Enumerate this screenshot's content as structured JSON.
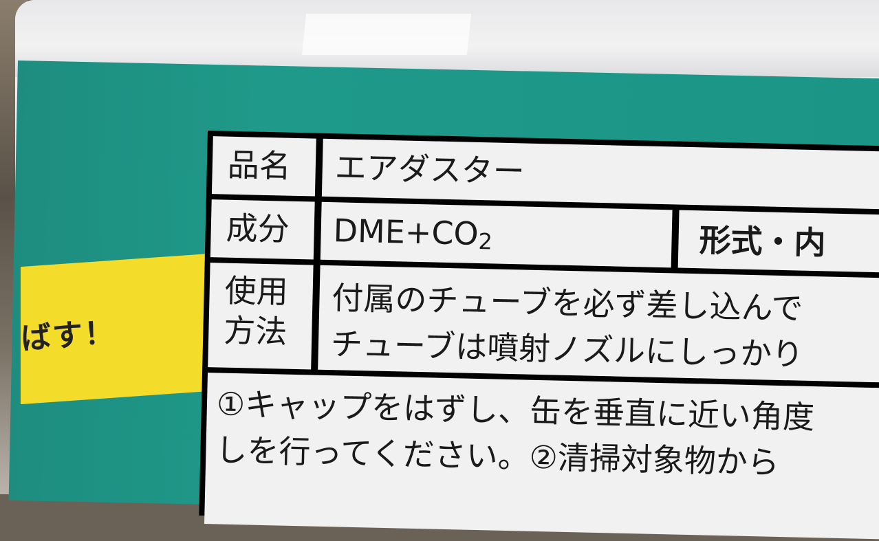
{
  "label": {
    "rows": [
      {
        "heading": "品名",
        "value": "エアダスター"
      },
      {
        "heading": "成分",
        "value": "DME+CO",
        "value_sub": "2",
        "extra": "形式・内"
      },
      {
        "heading_lines": [
          "使用",
          "方法"
        ],
        "value_lines": [
          "付属のチューブを必ず差し込んで",
          "チューブは噴射ノズルにしっかり"
        ]
      }
    ],
    "instructions": [
      "①キャップをはずし、缶を垂直に近い角度",
      "しを行ってください。②清掃対象物から"
    ]
  },
  "slogan": "ばす！",
  "colors": {
    "teal": "#1f9a8a",
    "yellow": "#f4dd2a",
    "label_bg": "#f1f1f1",
    "border": "#000000"
  }
}
